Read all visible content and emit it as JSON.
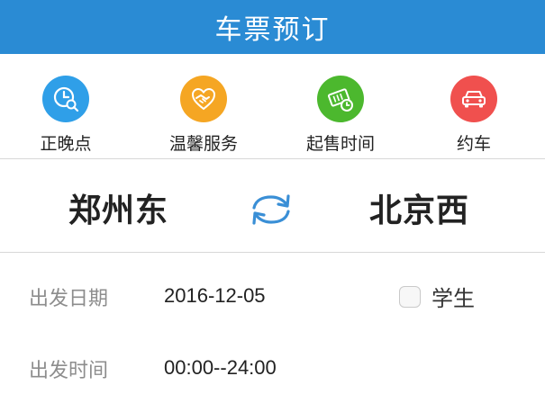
{
  "header": {
    "title": "车票预订"
  },
  "colors": {
    "header_bg": "#2a8bd4",
    "icon_late": "#2f9fe8",
    "icon_service": "#f5a623",
    "icon_sale": "#4cb82e",
    "icon_car": "#f0504e",
    "swap_icon": "#3a8fd6"
  },
  "quick_links": [
    {
      "label": "正晚点",
      "icon": "clock-search-icon"
    },
    {
      "label": "温馨服务",
      "icon": "handshake-heart-icon"
    },
    {
      "label": "起售时间",
      "icon": "ticket-clock-icon"
    },
    {
      "label": "约车",
      "icon": "car-icon"
    }
  ],
  "route": {
    "from": "郑州东",
    "to": "北京西",
    "swap_icon": "swap-arrows-icon"
  },
  "form": {
    "date_label": "出发日期",
    "date_value": "2016-12-05",
    "student_label": "学生",
    "time_label": "出发时间",
    "time_value": "00:00--24:00"
  }
}
